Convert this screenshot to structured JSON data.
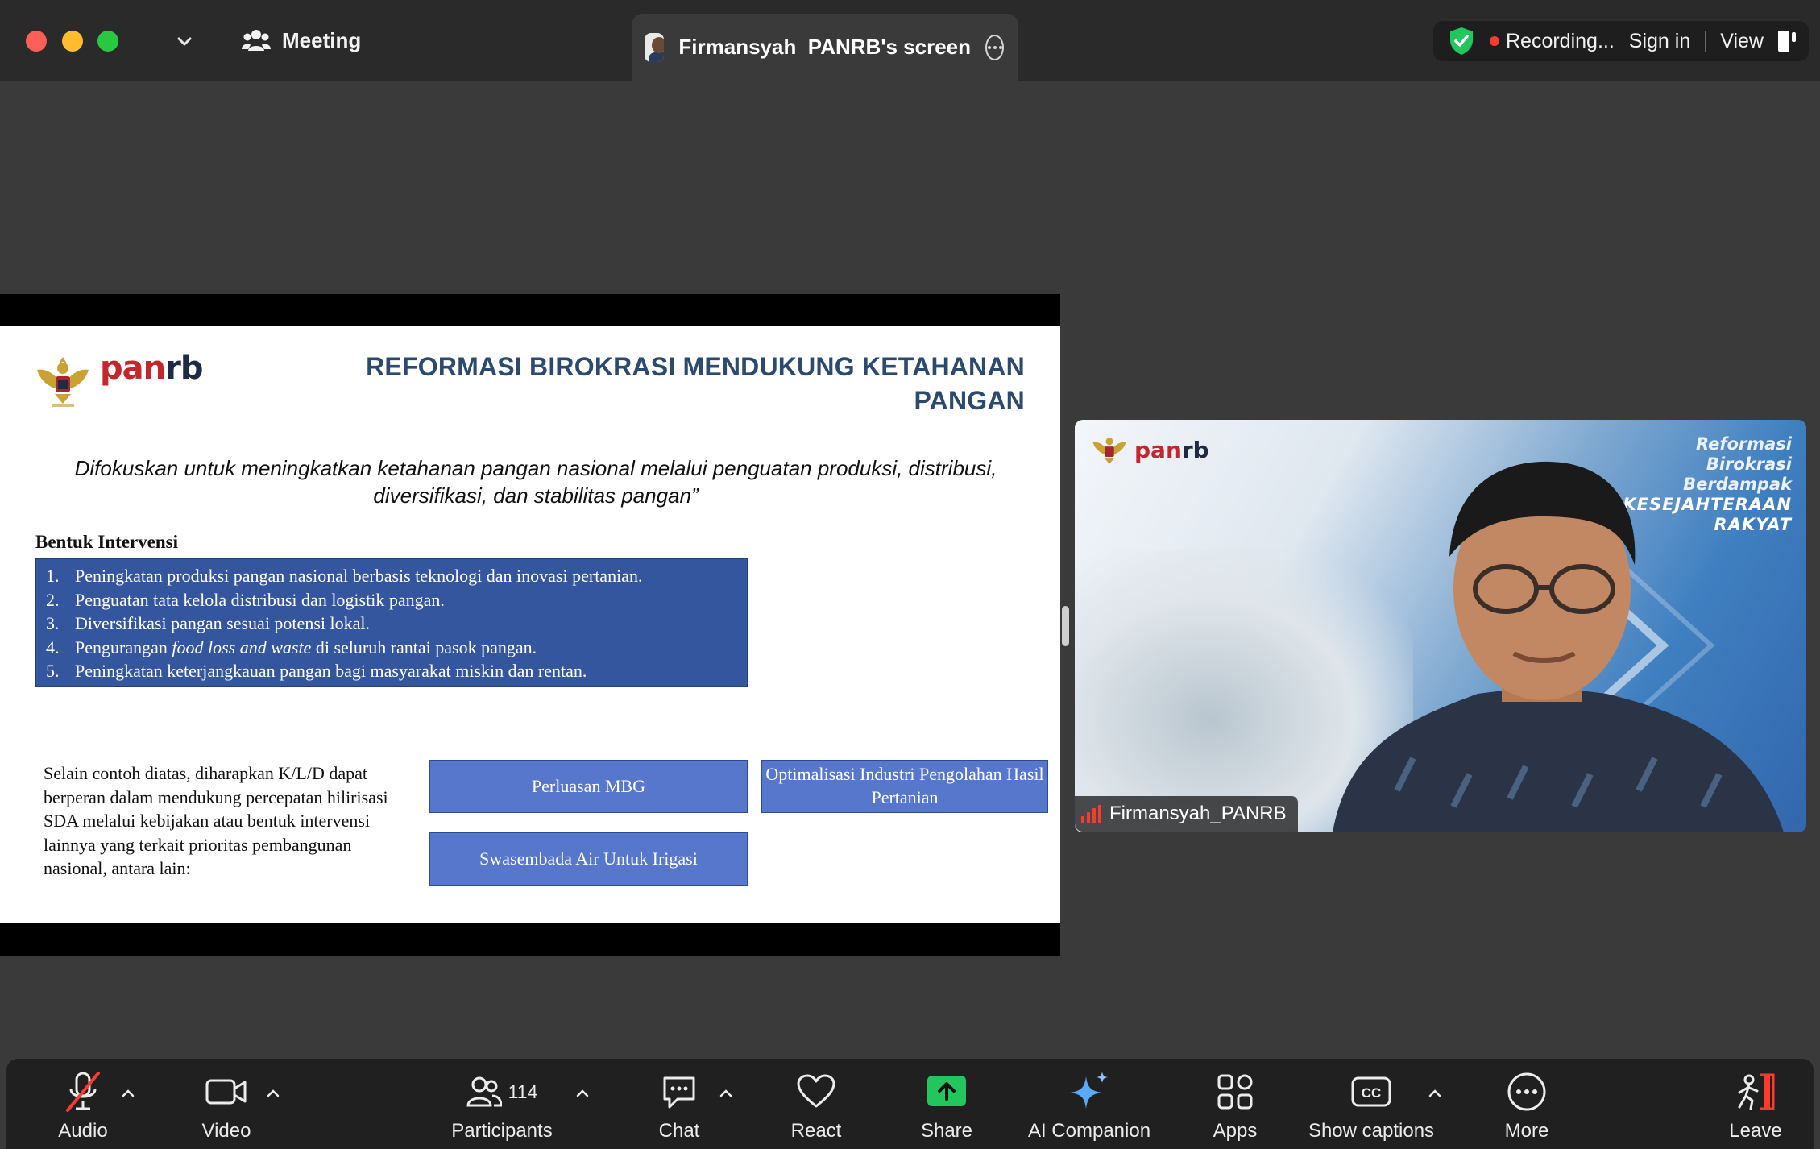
{
  "titlebar": {
    "meeting_label": "Meeting",
    "screen_tab_label": "Firmansyah_PANRB's screen",
    "recording_label": "Recording...",
    "sign_in_label": "Sign in",
    "view_label": "View"
  },
  "slide": {
    "logo_text_pan": "pan",
    "logo_text_rb": "rb",
    "title": "REFORMASI BIROKRASI MENDUKUNG KETAHANAN PANGAN",
    "quote": "Difokuskan untuk meningkatkan ketahanan pangan nasional melalui penguatan produksi, distribusi, diversifikasi, dan stabilitas pangan”",
    "bentuk_heading": "Bentuk Intervensi",
    "interventions": [
      {
        "num": "1.",
        "text": "Peningkatan produksi pangan nasional berbasis teknologi dan inovasi pertanian."
      },
      {
        "num": "2.",
        "text": "Penguatan tata kelola distribusi dan logistik pangan."
      },
      {
        "num": "3.",
        "text": "Diversifikasi pangan sesuai potensi lokal."
      },
      {
        "num": "4.",
        "pre": "Pengurangan ",
        "em": "food loss and waste",
        "post": " di seluruh rantai pasok pangan."
      },
      {
        "num": "5.",
        "text": "Peningkatan keterjangkauan pangan bagi masyarakat miskin dan rentan."
      }
    ],
    "selain_text": "Selain contoh diatas, diharapkan K/L/D dapat berperan dalam mendukung percepatan hilirisasi SDA melalui kebijakan atau bentuk intervensi lainnya yang terkait prioritas pembangunan nasional, antara lain:",
    "button_1": "Perluasan MBG",
    "button_2": "Optimalisasi Industri Pengolahan Hasil Pertanian",
    "button_3": "Swasembada Air Untuk Irigasi"
  },
  "video": {
    "logo_pan": "pan",
    "logo_rb": "rb",
    "banner_line1": "Reformasi",
    "banner_line2": "Birokrasi",
    "banner_line3": "Berdampak",
    "banner_line4": "KESEJAHTERAAN",
    "banner_line5": "RAKYAT",
    "participant_name": "Firmansyah_PANRB"
  },
  "toolbar": {
    "audio": "Audio",
    "video": "Video",
    "participants": "Participants",
    "participant_count": "114",
    "chat": "Chat",
    "react": "React",
    "share": "Share",
    "ai_companion": "AI Companion",
    "apps": "Apps",
    "show_captions": "Show captions",
    "more": "More",
    "leave": "Leave"
  },
  "colors": {
    "share_green": "#22c55e",
    "recording_red": "#ff3b30",
    "shield_green": "#22c55e",
    "slide_title_blue": "#2c4a6e",
    "intervention_box_blue": "#34569f",
    "button_blue": "#5777cc"
  },
  "icons": [
    "close-window-icon",
    "minimize-window-icon",
    "zoom-window-icon",
    "chevron-down-icon",
    "participants-group-icon",
    "more-options-icon",
    "shield-check-icon",
    "recording-dot-icon",
    "view-layout-icon",
    "microphone-muted-icon",
    "video-camera-icon",
    "participants-icon",
    "chat-icon",
    "heart-icon",
    "share-arrow-icon",
    "sparkle-icon",
    "apps-icon",
    "closed-captions-icon",
    "more-icon",
    "leave-icon"
  ]
}
